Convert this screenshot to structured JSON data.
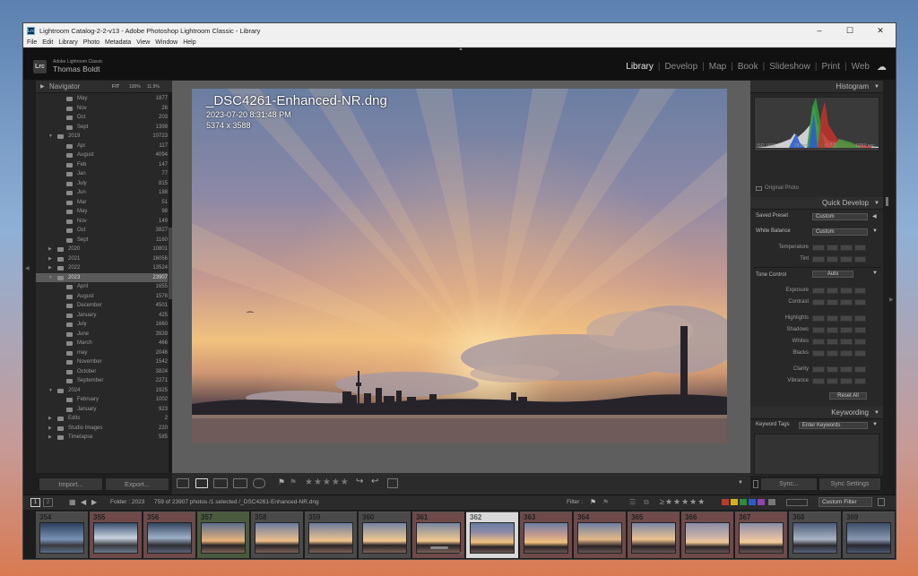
{
  "window": {
    "title": "Lightroom Catalog-2-2-v13 - Adobe Photoshop Lightroom Classic - Library",
    "app_icon": "Lrc"
  },
  "menu": [
    "File",
    "Edit",
    "Library",
    "Photo",
    "Metadata",
    "View",
    "Window",
    "Help"
  ],
  "identity": {
    "line1": "Adobe Lightroom Classic",
    "line2": "Thomas Boldt",
    "logo": "Lrc"
  },
  "modules": [
    "Library",
    "Develop",
    "Map",
    "Book",
    "Slideshow",
    "Print",
    "Web"
  ],
  "active_module": "Library",
  "left_panel": {
    "navigator_label": "Navigator",
    "zoom_fit": "FIT",
    "zoom_100": "100%",
    "zoom_ratio": "11.5%",
    "folders": [
      {
        "name": "May",
        "count": "1877",
        "level": 2
      },
      {
        "name": "Nov",
        "count": "26",
        "level": 2
      },
      {
        "name": "Oct",
        "count": "203",
        "level": 2
      },
      {
        "name": "Sept",
        "count": "1399",
        "level": 2
      },
      {
        "name": "2019",
        "count": "10723",
        "level": 1,
        "open": true
      },
      {
        "name": "Apr",
        "count": "117",
        "level": 2
      },
      {
        "name": "August",
        "count": "4094",
        "level": 2
      },
      {
        "name": "Feb",
        "count": "147",
        "level": 2
      },
      {
        "name": "Jan",
        "count": "77",
        "level": 2
      },
      {
        "name": "July",
        "count": "815",
        "level": 2
      },
      {
        "name": "Jun",
        "count": "188",
        "level": 2
      },
      {
        "name": "Mar",
        "count": "51",
        "level": 2
      },
      {
        "name": "May",
        "count": "98",
        "level": 2
      },
      {
        "name": "Nov",
        "count": "149",
        "level": 2
      },
      {
        "name": "Oct",
        "count": "3827",
        "level": 2
      },
      {
        "name": "Sept",
        "count": "1160",
        "level": 2
      },
      {
        "name": "2020",
        "count": "10801",
        "level": 1
      },
      {
        "name": "2021",
        "count": "16056",
        "level": 1
      },
      {
        "name": "2022",
        "count": "13524",
        "level": 1
      },
      {
        "name": "2023",
        "count": "23907",
        "level": 1,
        "open": true,
        "selected": true
      },
      {
        "name": "April",
        "count": "1655",
        "level": 2
      },
      {
        "name": "August",
        "count": "1578",
        "level": 2
      },
      {
        "name": "December",
        "count": "4501",
        "level": 2
      },
      {
        "name": "January",
        "count": "425",
        "level": 2
      },
      {
        "name": "July",
        "count": "1660",
        "level": 2
      },
      {
        "name": "June",
        "count": "3939",
        "level": 2
      },
      {
        "name": "March",
        "count": "466",
        "level": 2
      },
      {
        "name": "may",
        "count": "2046",
        "level": 2
      },
      {
        "name": "November",
        "count": "1542",
        "level": 2
      },
      {
        "name": "October",
        "count": "3824",
        "level": 2
      },
      {
        "name": "September",
        "count": "2271",
        "level": 2
      },
      {
        "name": "2024",
        "count": "1925",
        "level": 1,
        "open": true
      },
      {
        "name": "February",
        "count": "1002",
        "level": 2
      },
      {
        "name": "January",
        "count": "923",
        "level": 2
      },
      {
        "name": "Edits",
        "count": "2",
        "level": 1
      },
      {
        "name": "Studio Images",
        "count": "220",
        "level": 1
      },
      {
        "name": "Timelapse",
        "count": "585",
        "level": 1
      }
    ],
    "import_label": "Import...",
    "export_label": "Export..."
  },
  "photo": {
    "filename": "_DSC4261-Enhanced-NR.dng",
    "datetime": "2023-07-20 8:31:48 PM",
    "dimensions": "5374 x 3588"
  },
  "right_panel": {
    "histogram_label": "Histogram",
    "exif": {
      "iso": "ISO 1600",
      "focal": "28 mm",
      "aperture": "f / 7.1",
      "shutter": "1/250 sec"
    },
    "original_photo": "Original Photo",
    "quick_develop_label": "Quick Develop",
    "saved_preset_label": "Saved Preset",
    "saved_preset_value": "Custom",
    "white_balance_label": "White Balance",
    "white_balance_value": "Custom",
    "wb_rows": [
      "Temperature",
      "Tint"
    ],
    "tone_control_label": "Tone Control",
    "auto_label": "Auto",
    "tone_rows": [
      "Exposure",
      "Contrast",
      "Highlights",
      "Shadows",
      "Whites",
      "Blacks",
      "Clarity",
      "Vibrance"
    ],
    "reset_label": "Reset All",
    "keywording_label": "Keywording",
    "keyword_tags_label": "Keyword Tags",
    "keyword_tags_value": "Enter Keywords",
    "sync_label": "Sync...",
    "sync_settings_label": "Sync Settings"
  },
  "toolbar": {
    "stars": "★★★★★"
  },
  "filmstrip_bar": {
    "page1": "1",
    "page2": "2",
    "source": "Folder : 2023",
    "count": "759 of 23907 photos /1 selected /_DSC4261-Enhanced-NR.dng",
    "filter_label": "Filter :",
    "custom_filter": "Custom Filter"
  },
  "filmstrip": [
    {
      "num": "354"
    },
    {
      "num": "355"
    },
    {
      "num": "356"
    },
    {
      "num": "357"
    },
    {
      "num": "358"
    },
    {
      "num": "359"
    },
    {
      "num": "360"
    },
    {
      "num": "361"
    },
    {
      "num": "362",
      "selected": true
    },
    {
      "num": "363"
    },
    {
      "num": "364"
    },
    {
      "num": "365"
    },
    {
      "num": "366"
    },
    {
      "num": "367"
    },
    {
      "num": "368"
    },
    {
      "num": "369"
    }
  ],
  "colors": {
    "accent": "#e8e8e8",
    "panel": "#282828",
    "sky_top": "#6a7ea2",
    "glow": "#f1c27e"
  }
}
